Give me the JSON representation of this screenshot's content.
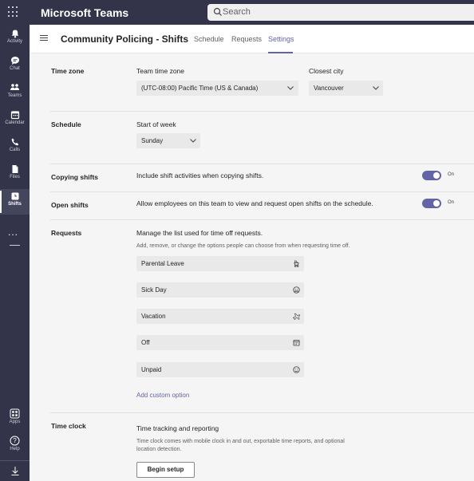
{
  "app": {
    "title": "Microsoft Teams"
  },
  "search": {
    "placeholder": "Search"
  },
  "rail": {
    "items": [
      {
        "label": "Activity",
        "icon": "bell-icon"
      },
      {
        "label": "Chat",
        "icon": "chat-icon"
      },
      {
        "label": "Teams",
        "icon": "teams-icon"
      },
      {
        "label": "Calendar",
        "icon": "calendar-icon"
      },
      {
        "label": "Calls",
        "icon": "phone-icon"
      },
      {
        "label": "Files",
        "icon": "file-icon"
      },
      {
        "label": "Shifts",
        "icon": "clock-icon",
        "active": true
      }
    ],
    "more": "...",
    "bottom": [
      {
        "label": "Apps",
        "icon": "apps-icon"
      },
      {
        "label": "Help",
        "icon": "help-icon"
      },
      {
        "label": "",
        "icon": "download-icon"
      }
    ]
  },
  "header": {
    "title": "Community Policing - Shifts",
    "tabs": [
      {
        "label": "Schedule"
      },
      {
        "label": "Requests"
      },
      {
        "label": "Settings",
        "active": true
      }
    ]
  },
  "time_zone": {
    "section": "Time zone",
    "team_label": "Team time zone",
    "team_value": "(UTC-08:00) Pacific Time (US & Canada)",
    "city_label": "Closest city",
    "city_value": "Vancouver"
  },
  "schedule": {
    "section": "Schedule",
    "week_label": "Start of week",
    "week_value": "Sunday"
  },
  "copying": {
    "section": "Copying shifts",
    "description": "Include shift activities when copying shifts.",
    "toggle": "On"
  },
  "open_shifts": {
    "section": "Open shifts",
    "description": "Allow employees on this team to view and request open shifts on the schedule.",
    "toggle": "On"
  },
  "requests": {
    "section": "Requests",
    "description": "Manage the list used for time off requests.",
    "hint": "Add, remove, or change the options people can choose from when requesting time off.",
    "options": [
      {
        "label": "Parental Leave",
        "icon": "stroller-icon"
      },
      {
        "label": "Sick Day",
        "icon": "sick-face-icon"
      },
      {
        "label": "Vacation",
        "icon": "airplane-icon"
      },
      {
        "label": "Off",
        "icon": "calendar-icon"
      },
      {
        "label": "Unpaid",
        "icon": "smiley-icon"
      }
    ],
    "add_label": "Add custom option"
  },
  "time_clock": {
    "section": "Time clock",
    "title": "Time tracking and reporting",
    "description_1": "Time clock comes with mobile clock in and out, exportable time reports, and optional",
    "description_2": "location detection.",
    "button": "Begin setup"
  },
  "colors": {
    "rail": "#33344a",
    "accent": "#6264a7"
  }
}
